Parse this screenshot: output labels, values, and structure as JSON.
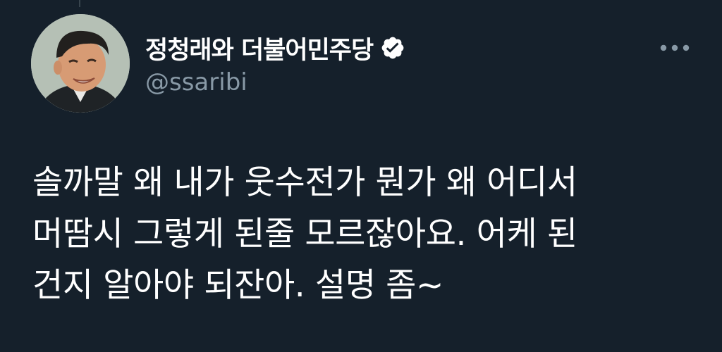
{
  "colors": {
    "background": "#15202b",
    "text_primary": "#ffffff",
    "text_secondary": "#8899a6",
    "verified_badge": "#ffffff"
  },
  "author": {
    "display_name": "정청래와 더불어민주당",
    "handle": "@ssaribi",
    "verified": true,
    "avatar_icon": "avatar"
  },
  "tweet": {
    "text": "솔까말 왜 내가 웃수전가 뭔가 왜 어디서\n머땀시 그렇게 된줄 모르잖아요. 어케 된\n건지 알아야 되잔아. 설명 좀~"
  },
  "icons": {
    "verified": "verified-badge-icon",
    "more": "more-options-icon"
  }
}
